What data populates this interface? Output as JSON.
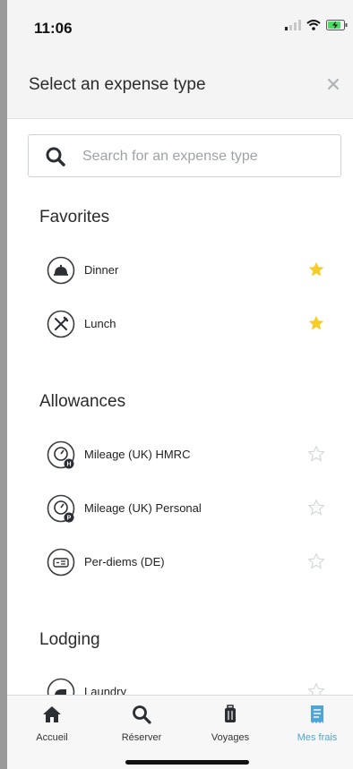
{
  "status_bar": {
    "time": "11:06"
  },
  "header": {
    "title": "Select an expense type",
    "close_icon": "close-icon"
  },
  "search": {
    "placeholder": "Search for an expense type",
    "value": ""
  },
  "sections": {
    "favorites": {
      "title": "Favorites",
      "items": [
        {
          "label": "Dinner",
          "icon": "dinner-cloche-icon",
          "favorite": true
        },
        {
          "label": "Lunch",
          "icon": "fork-knife-icon",
          "favorite": true
        }
      ]
    },
    "allowances": {
      "title": "Allowances",
      "items": [
        {
          "label": "Mileage (UK) HMRC",
          "icon": "odometer-icon",
          "badge": "H",
          "favorite": false
        },
        {
          "label": "Mileage (UK) Personal",
          "icon": "odometer-icon",
          "badge": "P",
          "favorite": false
        },
        {
          "label": "Per-diems (DE)",
          "icon": "per-diem-icon",
          "favorite": false
        }
      ]
    },
    "lodging": {
      "title": "Lodging",
      "items": [
        {
          "label": "Laundry",
          "icon": "iron-icon",
          "favorite": false
        }
      ]
    }
  },
  "tabbar": {
    "tabs": [
      {
        "label": "Accueil",
        "icon": "home-icon",
        "active": false
      },
      {
        "label": "Réserver",
        "icon": "search-icon",
        "active": false
      },
      {
        "label": "Voyages",
        "icon": "luggage-icon",
        "active": false
      },
      {
        "label": "Mes frais",
        "icon": "receipt-icon",
        "active": true
      }
    ]
  },
  "colors": {
    "star_active": "#f5cc2a",
    "star_inactive": "#d0d4d8",
    "tab_active": "#4da6d6",
    "icon_stroke": "#3a3f44"
  }
}
